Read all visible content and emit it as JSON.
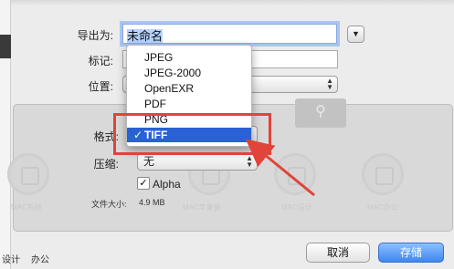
{
  "dialog": {
    "export_as_label": "导出为:",
    "filename_value": "未命名",
    "tags_label": "标记:",
    "location_label": "位置:",
    "format_label": "格式:",
    "compression_label": "压缩:",
    "compression_value": "无",
    "alpha_label": "Alpha",
    "alpha_checked": "✓",
    "filesize_label": "文件大小:",
    "filesize_value": "4.9 MB",
    "cancel_label": "取消",
    "save_label": "存储"
  },
  "format_menu": {
    "items": [
      "JPEG",
      "JPEG-2000",
      "OpenEXR",
      "PDF",
      "PNG",
      "TIFF"
    ],
    "selected": "TIFF",
    "check_mark": "✓"
  },
  "background": {
    "bottom_left_text_1": "设计",
    "bottom_left_text_2": "办公",
    "watermark_captions": [
      "MAC系统",
      "MAC苹果装",
      "MAC设计",
      "MAC办公"
    ]
  },
  "annotation": {
    "color": "#e0443a"
  },
  "colors": {
    "accent": "#2a62d6",
    "save_button": "#3f86f0"
  }
}
